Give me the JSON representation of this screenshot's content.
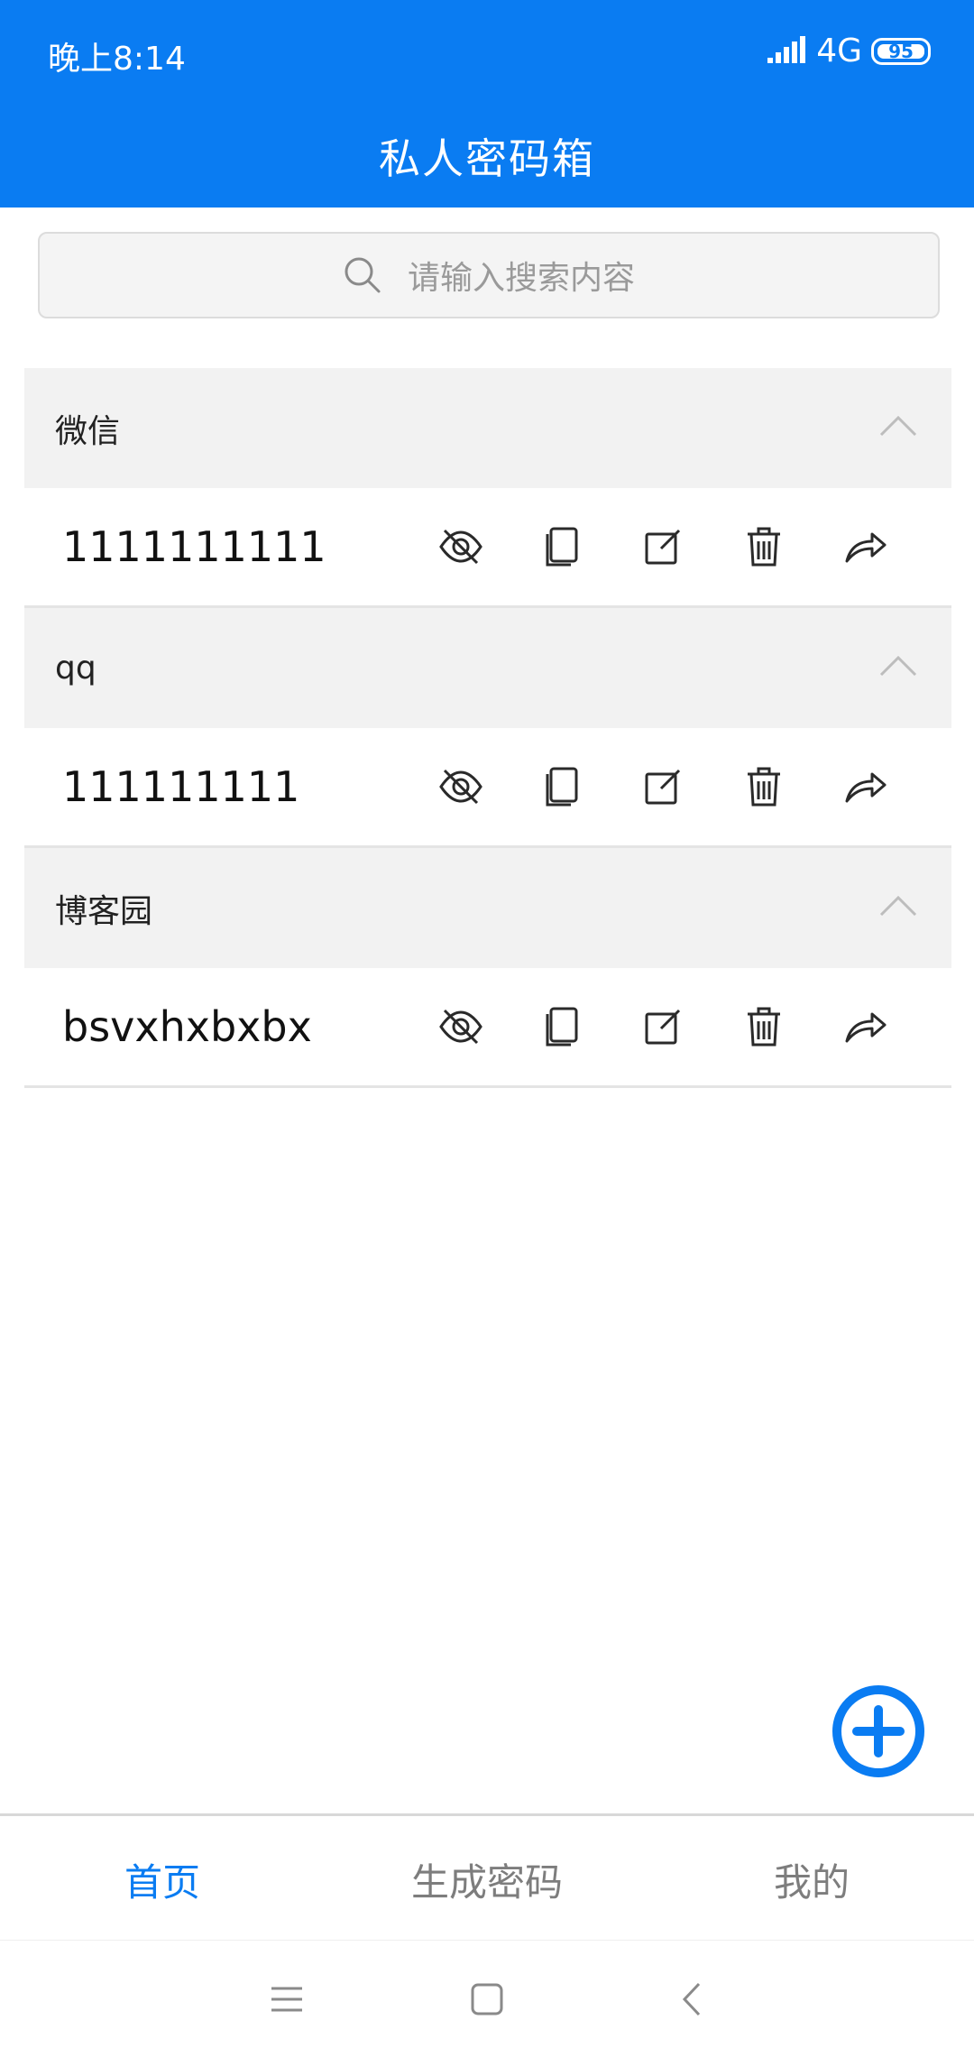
{
  "status_bar": {
    "time": "晚上8:14",
    "network": "4G",
    "battery": "95"
  },
  "header": {
    "title": "私人密码箱"
  },
  "search": {
    "placeholder": "请输入搜索内容"
  },
  "groups": [
    {
      "title": "微信",
      "entry": "1111111111"
    },
    {
      "title": "qq",
      "entry": "111111111"
    },
    {
      "title": "博客园",
      "entry": "bsvxhxbxbx"
    }
  ],
  "tabs": [
    {
      "label": "首页",
      "active": true
    },
    {
      "label": "生成密码",
      "active": false
    },
    {
      "label": "我的",
      "active": false
    }
  ],
  "icons": {
    "toggle_visibility": "eye-off-icon",
    "copy": "copy-icon",
    "edit": "edit-icon",
    "delete": "trash-icon",
    "share": "share-icon",
    "add": "add-circle-icon"
  },
  "colors": {
    "brand": "#0a7cf2",
    "icon": "#2a2a2a",
    "muted": "#7d7d7d"
  }
}
